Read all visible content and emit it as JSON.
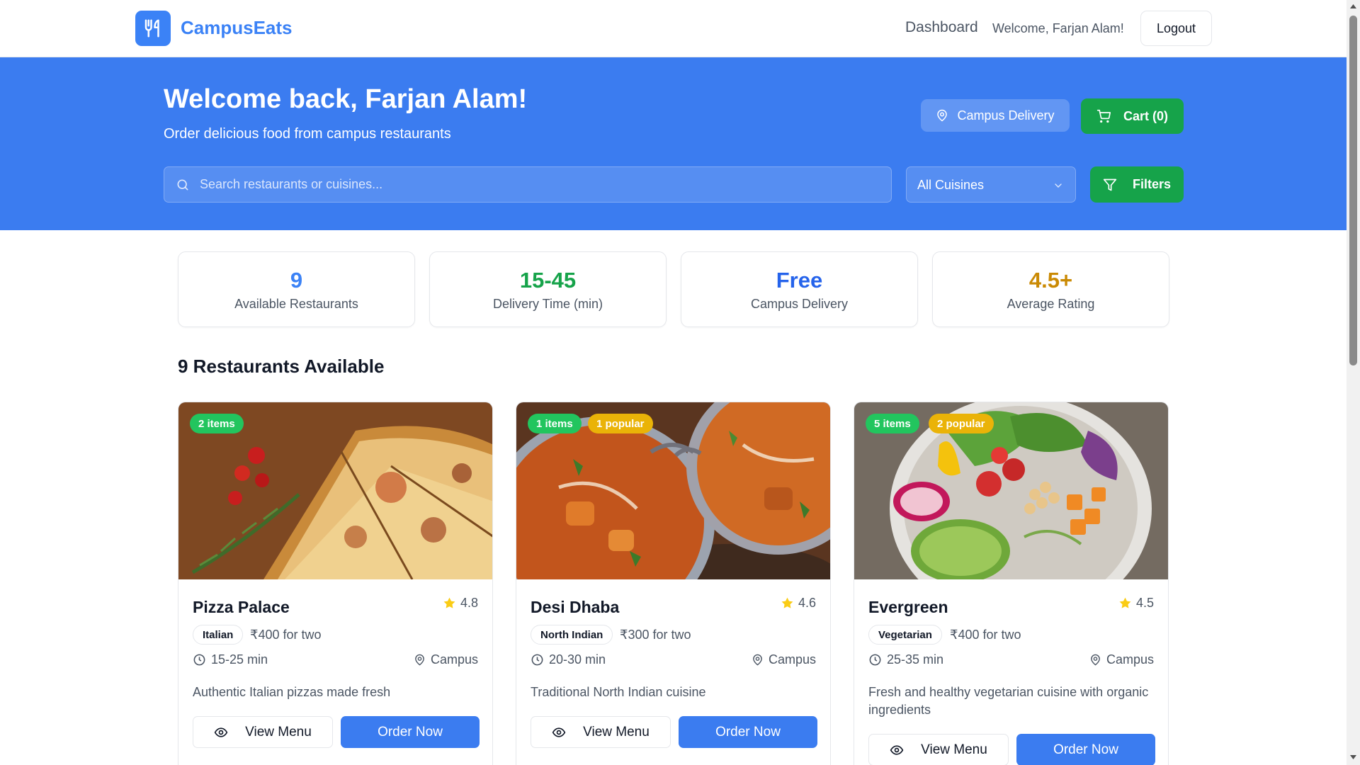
{
  "app": {
    "name": "CampusEats",
    "logo_icon": "fork-knife-icon",
    "brand_color": "#3b82f6"
  },
  "nav": {
    "dashboard_label": "Dashboard",
    "welcome_text": "Welcome, Farjan Alam!",
    "logout_label": "Logout"
  },
  "hero": {
    "title": "Welcome back, Farjan Alam!",
    "subtitle": "Order delicious food from campus restaurants",
    "delivery_pill": "Campus Delivery",
    "cart_label": "Cart (0)",
    "search_placeholder": "Search restaurants or cuisines...",
    "cuisine_select": "All Cuisines",
    "filters_label": "Filters",
    "hero_color": "#3b7cf0",
    "accent_green": "#16a34a"
  },
  "stats": [
    {
      "value": "9",
      "label": "Available Restaurants",
      "color": "#3b82f6"
    },
    {
      "value": "15-45",
      "label": "Delivery Time (min)",
      "color": "#16a34a"
    },
    {
      "value": "Free",
      "label": "Campus Delivery",
      "color": "#2563eb"
    },
    {
      "value": "4.5+",
      "label": "Average Rating",
      "color": "#ca8a04"
    }
  ],
  "section_title": "9 Restaurants Available",
  "restaurants": [
    {
      "name": "Pizza Palace",
      "rating": "4.8",
      "cuisine": "Italian",
      "price": "₹400 for two",
      "time": "15-25 min",
      "location": "Campus",
      "description": "Authentic Italian pizzas made fresh",
      "items_badge": "2 items",
      "popular_badge": "",
      "view_label": "View Menu",
      "order_label": "Order Now",
      "image": "pizza"
    },
    {
      "name": "Desi Dhaba",
      "rating": "4.6",
      "cuisine": "North Indian",
      "price": "₹300 for two",
      "time": "20-30 min",
      "location": "Campus",
      "description": "Traditional North Indian cuisine",
      "items_badge": "1 items",
      "popular_badge": "1 popular",
      "view_label": "View Menu",
      "order_label": "Order Now",
      "image": "curry"
    },
    {
      "name": "Evergreen",
      "rating": "4.5",
      "cuisine": "Vegetarian",
      "price": "₹400 for two",
      "time": "25-35 min",
      "location": "Campus",
      "description": "Fresh and healthy vegetarian cuisine with organic ingredients",
      "items_badge": "5 items",
      "popular_badge": "2 popular",
      "view_label": "View Menu",
      "order_label": "Order Now",
      "image": "salad"
    }
  ]
}
